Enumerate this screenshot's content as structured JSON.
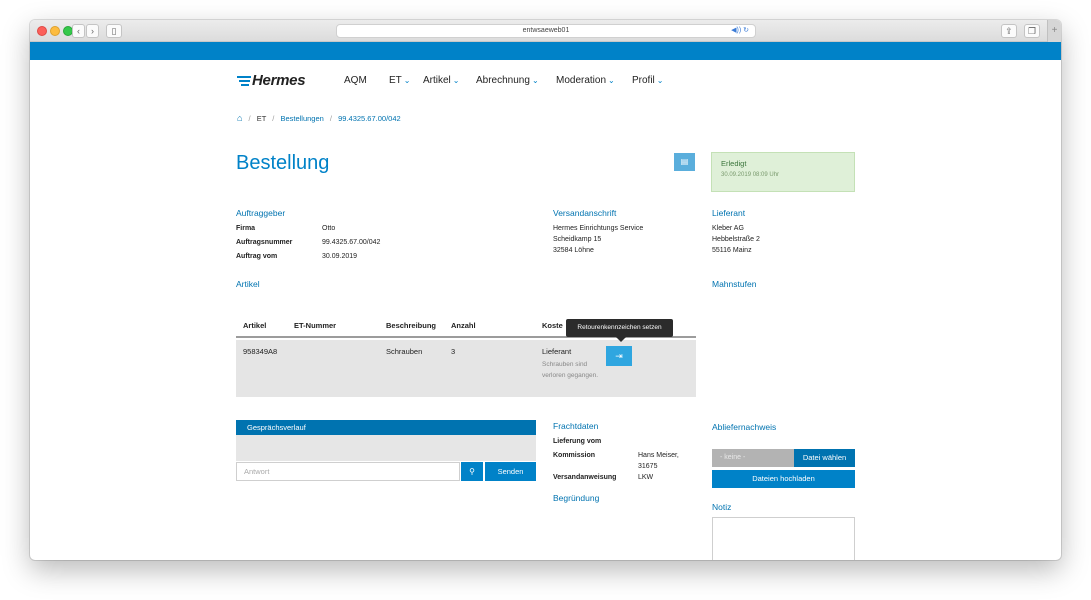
{
  "browser": {
    "url": "entwsaeweb01",
    "nav_back": "‹",
    "nav_fwd": "›",
    "share": "⇪",
    "tabs": "❐",
    "plus": "+",
    "url_icons": "◀)) ↻"
  },
  "header": {
    "logo": "Hermes",
    "nav": [
      {
        "label": "AQM",
        "dropdown": false
      },
      {
        "label": "ET",
        "dropdown": true
      },
      {
        "label": "Artikel",
        "dropdown": true
      },
      {
        "label": "Abrechnung",
        "dropdown": true
      },
      {
        "label": "Moderation",
        "dropdown": true
      },
      {
        "label": "Profil",
        "dropdown": true
      }
    ],
    "chevron": "⌄"
  },
  "breadcrumb": {
    "home_icon": "⌂",
    "sep": "/",
    "items": [
      "ET",
      "Bestellungen",
      "99.4325.67.00/042"
    ]
  },
  "page": {
    "title": "Bestellung",
    "pdf_icon": "▤"
  },
  "status": {
    "label": "Erledigt",
    "date": "30.09.2019 08:09 Uhr",
    "color": "#dff0d8"
  },
  "auftraggeber": {
    "heading": "Auftraggeber",
    "rows": [
      {
        "label": "Firma",
        "value": "Otto"
      },
      {
        "label": "Auftragsnummer",
        "value": "99.4325.67.00/042"
      },
      {
        "label": "Auftrag vom",
        "value": "30.09.2019"
      }
    ]
  },
  "versandanschrift": {
    "heading": "Versandanschrift",
    "lines": [
      "Hermes Einrichtungs Service",
      "Scheidkamp 15",
      "32584 Löhne"
    ]
  },
  "lieferant": {
    "heading": "Lieferant",
    "lines": [
      "Kleber AG",
      "Hebbelstraße 2",
      "55116 Mainz"
    ]
  },
  "mahnstufen": {
    "heading": "Mahnstufen"
  },
  "artikel": {
    "heading": "Artikel",
    "columns": [
      "Artikel",
      "ET-Nummer",
      "Beschreibung",
      "Anzahl",
      "Koste"
    ],
    "rows": [
      {
        "artikel": "958349A8",
        "et_nummer": "",
        "beschreibung": "Schrauben",
        "anzahl": "3",
        "kosten": "Lieferant",
        "note": "Schrauben sind verloren gegangen.",
        "action_icon": "⇥"
      }
    ],
    "tooltip": "Retourenkennzeichen setzen"
  },
  "gespraechsverlauf": {
    "heading": "Gesprächsverlauf",
    "placeholder": "Antwort",
    "attach_icon": "⚲",
    "send": "Senden"
  },
  "frachtdaten": {
    "heading": "Frachtdaten",
    "rows": [
      {
        "label": "Lieferung vom",
        "value": ""
      },
      {
        "label": "Kommission",
        "value": "Hans Meiser,"
      },
      {
        "label": "",
        "value": "31675"
      },
      {
        "label": "Versandanweisung",
        "value": "LKW"
      }
    ],
    "begruendung": "Begründung"
  },
  "abliefernachweis": {
    "heading": "Abliefernachweis",
    "none": "- keine -",
    "choose": "Datei wählen",
    "upload": "Dateien hochladen",
    "notiz": "Notiz"
  }
}
